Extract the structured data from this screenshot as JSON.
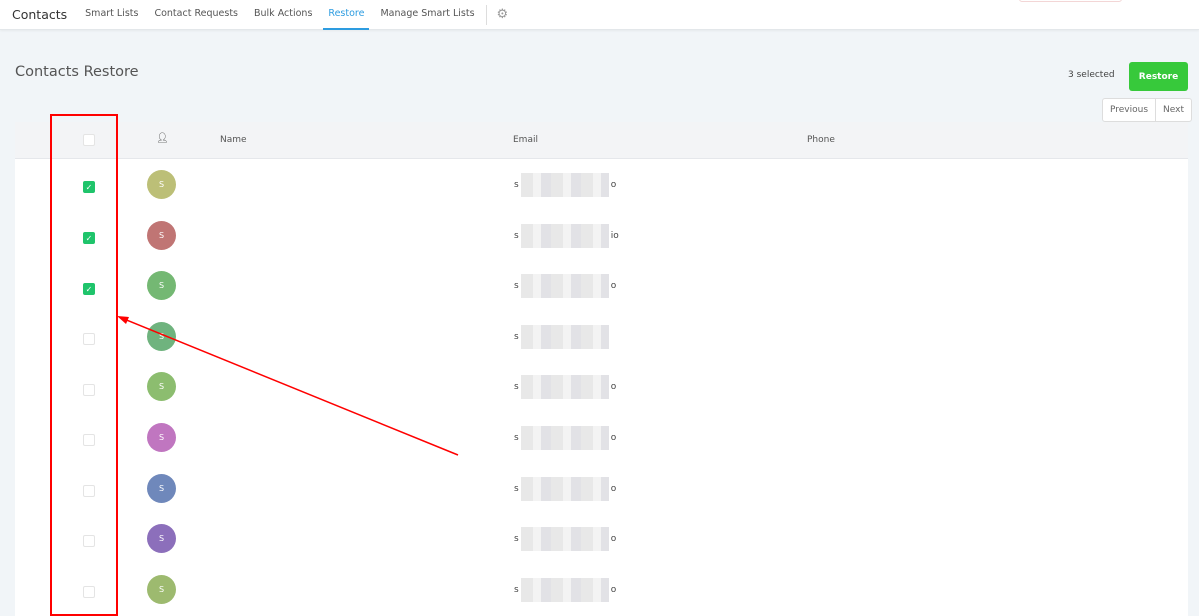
{
  "nav": {
    "brand": "Contacts",
    "tabs": [
      "Smart Lists",
      "Contact Requests",
      "Bulk Actions",
      "Restore",
      "Manage Smart Lists"
    ],
    "active": "Restore",
    "settings_icon": "gear-icon"
  },
  "page": {
    "title": "Contacts Restore",
    "selected_text": "3 selected",
    "restore_label": "Restore",
    "previous_label": "Previous",
    "next_label": "Next"
  },
  "table": {
    "columns": {
      "avatar_icon": "user-icon",
      "name": "Name",
      "email": "Email",
      "phone": "Phone"
    },
    "rows": [
      {
        "checked": true,
        "initial": "S",
        "color": "#bcbf77",
        "email_start": "s",
        "email_end": "o"
      },
      {
        "checked": true,
        "initial": "S",
        "color": "#c07574",
        "email_start": "s",
        "email_end": "io"
      },
      {
        "checked": true,
        "initial": "S",
        "color": "#74b873",
        "email_start": "s",
        "email_end": "o"
      },
      {
        "checked": false,
        "initial": "S",
        "color": "#6fb37e",
        "email_start": "s",
        "email_end": ""
      },
      {
        "checked": false,
        "initial": "S",
        "color": "#8cbd6f",
        "email_start": "s",
        "email_end": "o"
      },
      {
        "checked": false,
        "initial": "S",
        "color": "#c076c0",
        "email_start": "s",
        "email_end": "o"
      },
      {
        "checked": false,
        "initial": "S",
        "color": "#6f88bb",
        "email_start": "s",
        "email_end": "o"
      },
      {
        "checked": false,
        "initial": "S",
        "color": "#8c6fbb",
        "email_start": "s",
        "email_end": "o"
      },
      {
        "checked": false,
        "initial": "S",
        "color": "#9dba6f",
        "email_start": "s",
        "email_end": "o"
      }
    ]
  },
  "colors": {
    "accent": "#2d9ce0",
    "restore": "#37c93b",
    "check": "#1fc46b",
    "annotation": "#ff0000"
  }
}
